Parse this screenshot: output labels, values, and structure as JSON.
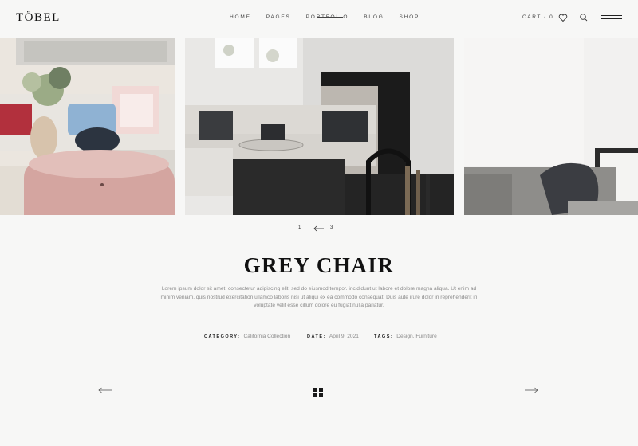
{
  "header": {
    "logo": "TÖBEL",
    "nav": [
      "HOME",
      "PAGES",
      "PORTFOLIO",
      "BLOG",
      "SHOP"
    ],
    "active_nav": "PORTFOLIO",
    "cart": "CART / 0",
    "icons": [
      "heart-icon",
      "search-icon",
      "menu-icon"
    ]
  },
  "slider": {
    "images": [
      "living-room-pink-ottoman",
      "grey-sofa-fireplace",
      "grey-chair-wall"
    ],
    "pager": {
      "first": "1",
      "last": "3"
    }
  },
  "post": {
    "title": "GREY CHAIR",
    "description": "Lorem ipsum dolor sit amet, consectetur adipiscing elit, sed do eiusmod tempor. incididunt ut labore et dolore magna aliqua. Ut enim ad minim veniam, quis nostrud exercitation ullamco laboris nisi ut aliqui ex ea commodo consequat. Duis aute irure dolor in reprehenderit in voluptate velit esse cillum dolore eu fugiat nulla pariatur.",
    "meta": {
      "category_label": "CATEGORY:",
      "category": "California Collection",
      "date_label": "DATE:",
      "date": "April 9, 2021",
      "tags_label": "TAGS:",
      "tags": "Design, Furniture"
    }
  },
  "colors": {
    "background": "#f7f7f6",
    "text": "#1a1a1a",
    "muted": "#8a8a8a"
  }
}
